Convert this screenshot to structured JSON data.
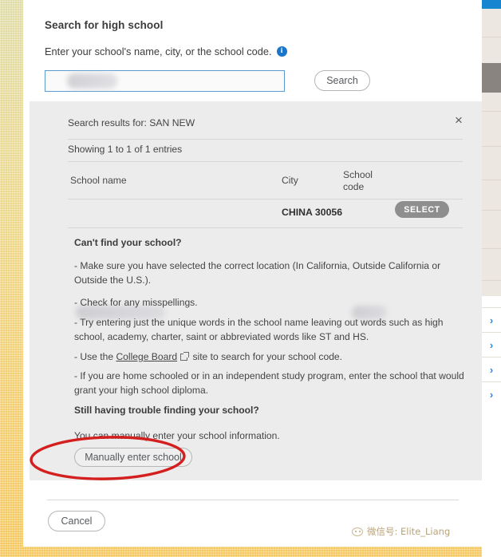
{
  "search": {
    "title": "Search for high school",
    "subtitle": "Enter your school's name, city, or the school code.",
    "info_icon": "info-icon",
    "input_value": "",
    "input_placeholder": "",
    "search_button": "Search"
  },
  "results": {
    "heading": "Search results for: SAN NEW",
    "close_label": "×",
    "showing": "Showing 1 to 1 of 1 entries",
    "columns": [
      "School name",
      "City",
      "School code"
    ],
    "rows": [
      {
        "school_name": "",
        "city": "CHINA 30056",
        "school_code": "",
        "action": "SELECT"
      }
    ]
  },
  "help": {
    "cant_find": "Can't find your school?",
    "bullet_1": "- Make sure you have selected the correct location (In California, Outside California or Outside the U.S.).",
    "bullet_2": "- Check for any misspellings.",
    "bullet_3": "- Try entering just the unique words in the school name leaving out words such as high school, academy, charter, saint or abbreviated words like ST and HS.",
    "bullet_4_pre": "- Use the ",
    "bullet_4_link": "College Board",
    "bullet_4_post": " site to search for your school code.",
    "bullet_5": "- If you are home schooled or in an independent study program, enter the school that would grant your high school diploma.",
    "still_trouble": "Still having trouble finding your school?",
    "manual_note": "You can manually enter your school information.",
    "manual_button": "Manually enter school"
  },
  "footer": {
    "cancel_button": "Cancel"
  },
  "right_strip": {
    "chevrons": [
      "›",
      "›",
      "›",
      "›"
    ]
  },
  "watermark": {
    "text": "微信号: Elite_Liang",
    "icon": "wechat-icon"
  },
  "colors": {
    "accent_blue": "#1785d0",
    "info_blue": "#1976c8",
    "select_gray": "#8e8e8e",
    "panel_gray": "#ececec",
    "annotation_red": "#d41f1f",
    "gold_bg": "#f0cf7a"
  }
}
